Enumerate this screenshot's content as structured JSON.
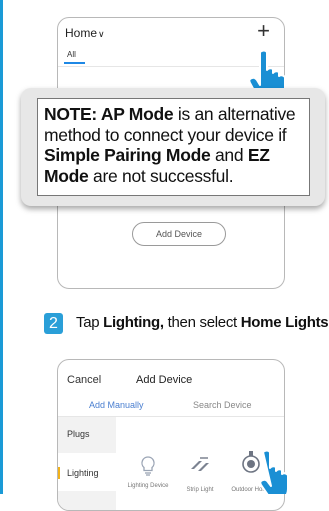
{
  "screen1": {
    "header_title": "Home",
    "chevron_icon": "chevron-down-icon",
    "plus_label": "+",
    "tab_all": "All",
    "add_device_button": "Add Device"
  },
  "note": {
    "prefix": "NOTE: AP Mode",
    "part1": " is an alternative method to connect your device if ",
    "simple_pairing": "Simple Pairing Mode",
    "and": " and ",
    "ez": "EZ Mode",
    "part2": " are not successful."
  },
  "step": {
    "number": "2",
    "tap": "Tap ",
    "lighting": "Lighting,",
    "then": " then select ",
    "home_lights": "Home Lights."
  },
  "screen2": {
    "cancel": "Cancel",
    "title": "Add Device",
    "tab_manual": "Add Manually",
    "tab_search": "Search Device",
    "categories": [
      "Plugs",
      "Lighting"
    ],
    "devices": [
      {
        "label": "Lighting Device",
        "icon": "bulb-icon"
      },
      {
        "label": "Strip Light",
        "icon": "strip-light-icon"
      },
      {
        "label": "Outdoor Home",
        "icon": "outdoor-light-icon"
      }
    ]
  },
  "colors": {
    "accent_blue": "#2a9fd8",
    "tab_blue": "#1e88e5",
    "hand_blue": "#1a8fd4",
    "category_marker": "#f2b21a"
  }
}
